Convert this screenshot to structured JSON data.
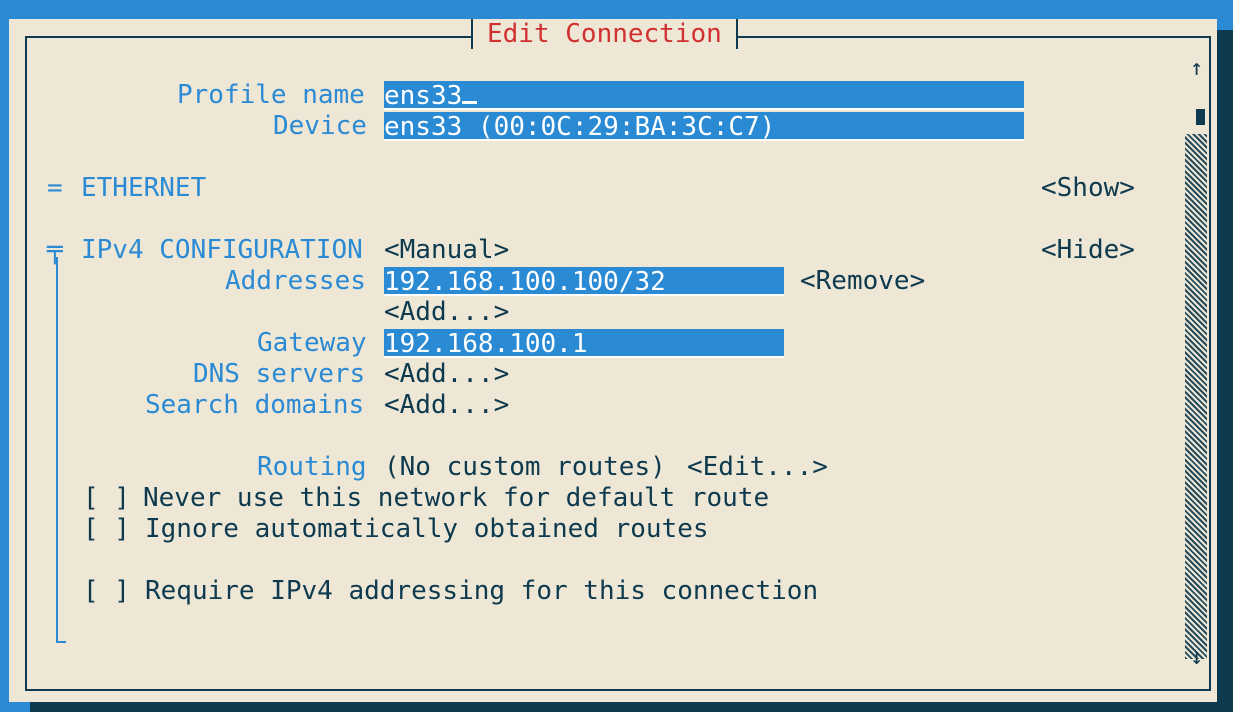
{
  "window": {
    "title": "Edit Connection"
  },
  "profile": {
    "label": "Profile name",
    "value": "ens33"
  },
  "device": {
    "label": "Device",
    "value": "ens33 (00:0C:29:BA:3C:C7)"
  },
  "ethernet": {
    "marker": "=",
    "heading": "ETHERNET",
    "toggle": "<Show>"
  },
  "ipv4": {
    "marker": "╤",
    "heading": "IPv4 CONFIGURATION",
    "mode": "<Manual>",
    "toggle": "<Hide>",
    "addresses_label": "Addresses",
    "address_value": "192.168.100.100/32",
    "remove": "<Remove>",
    "add_address": "<Add...>",
    "gateway_label": "Gateway",
    "gateway_value": "192.168.100.1",
    "dns_label": "DNS servers",
    "dns_add": "<Add...>",
    "search_label": "Search domains",
    "search_add": "<Add...>",
    "routing_label": "Routing",
    "routing_value": "(No custom routes)",
    "routing_edit": "<Edit...>",
    "never_default_box": "[ ]",
    "never_default_label": "Never use this network for default route",
    "ignore_routes_box": "[ ]",
    "ignore_routes_label": "Ignore automatically obtained routes",
    "require_box": "[ ]",
    "require_label": "Require IPv4 addressing for this connection"
  },
  "scrollbar": {
    "up": "↑",
    "down": "↓"
  }
}
